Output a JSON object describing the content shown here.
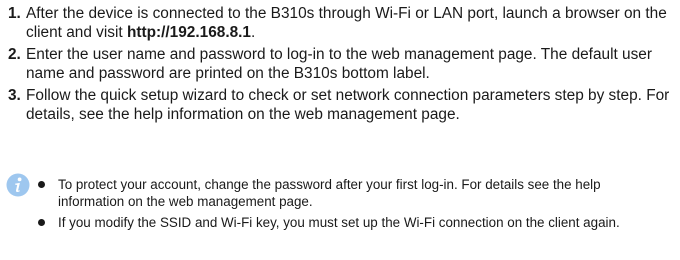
{
  "steps": [
    {
      "number": "1.",
      "text_before": "After the device is connected to the B310s through Wi-Fi or LAN port, launch a browser on the client and visit ",
      "url": "http://192.168.8.1",
      "text_after": "."
    },
    {
      "number": "2.",
      "text": "Enter the user name and password to log-in to the web management page. The default user name and password are printed on the B310s bottom label."
    },
    {
      "number": "3.",
      "text": "Follow the quick setup wizard to check or set network connection parameters step by step. For details, see the help information on the web management page."
    }
  ],
  "note": {
    "icon": "info-icon",
    "icon_color": "#9ec7ef",
    "bullets": [
      "To protect your account, change the password after your first log-in. For details see the help information on the web management page.",
      "If you modify the SSID and Wi-Fi key, you must set up the Wi-Fi connection on the client again."
    ]
  }
}
